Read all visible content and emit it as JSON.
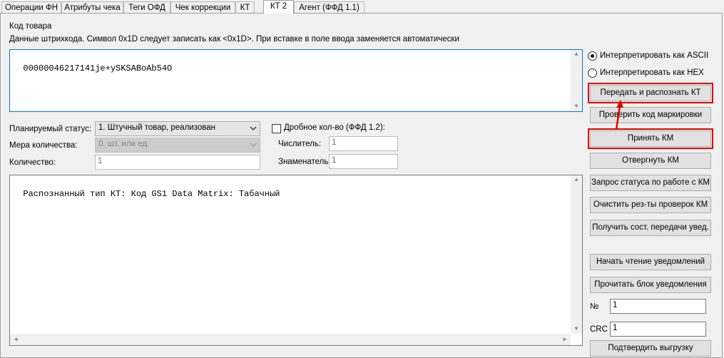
{
  "tabs": [
    {
      "label": "Операции ФН"
    },
    {
      "label": "Атрибуты чека"
    },
    {
      "label": "Теги ОФД"
    },
    {
      "label": "Чек коррекции"
    },
    {
      "label": "КТ"
    },
    {
      "label": "КТ 2"
    },
    {
      "label": "Агент (ФФД 1.1)"
    }
  ],
  "product_code_label": "Код товара",
  "barcode_hint": "Данные штрихкода. Символ 0x1D следует записать как <0x1D>. При вставке в поле ввода заменяется автоматически",
  "barcode_value": "00000046217141je+ySKSABoAb54O",
  "mode": {
    "ascii_label": "Интерпретировать как ASCII",
    "hex_label": "Интерпретировать как HEX",
    "selected": "ascii"
  },
  "planned_status": {
    "label": "Планируемый статус:",
    "value": "1. Штучный товар, реализован"
  },
  "quantity_measure": {
    "label": "Мера количества:",
    "value": "0. шт. или ед."
  },
  "quantity": {
    "label": "Количество:",
    "value": "1"
  },
  "fractional": {
    "label": "Дробное кол-во (ФФД 1.2):",
    "checked": false
  },
  "numerator": {
    "label": "Числитель:",
    "value": "1"
  },
  "denominator": {
    "label": "Знаменатель:",
    "value": "1"
  },
  "result_text": "Распознанный тип КТ: Код GS1 Data Matrix: Табачный",
  "buttons": {
    "send_recognize": "Передать и распознать КТ",
    "check_marking": "Проверить код маркировки",
    "accept_km": "Принять КМ",
    "reject_km": "Отвергнуть КМ",
    "status_request": "Запрос статуса по работе с КМ",
    "clear_results": "Очистить рез-ты проверок КМ",
    "get_transfer_state": "Получить сост. передачи увед.",
    "start_reading": "Начать чтение уведомлений",
    "read_block": "Прочитать блок уведомления",
    "confirm_upload": "Подтвердить выгрузку"
  },
  "number_field": {
    "label": "№",
    "value": "1"
  },
  "crc_field": {
    "label": "CRC",
    "value": "1"
  },
  "colors": {
    "highlight": "#e00000",
    "focus_border": "#0078d7"
  }
}
